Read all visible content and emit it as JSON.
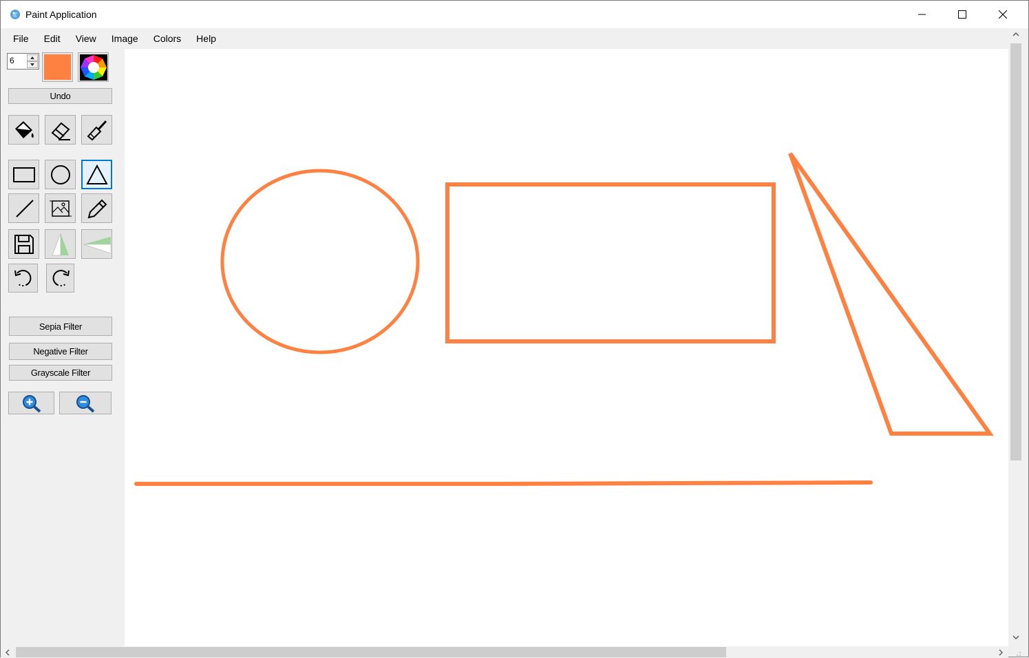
{
  "window": {
    "title": "Paint Application",
    "controls": [
      "minimize",
      "maximize",
      "close"
    ]
  },
  "menu": {
    "items": [
      "File",
      "Edit",
      "View",
      "Image",
      "Colors",
      "Help"
    ]
  },
  "toolbar": {
    "brush_size": "6",
    "current_color": "#ff8142",
    "undo_label": "Undo",
    "tools_row1": [
      "fill-bucket-icon",
      "eraser-icon",
      "brush-icon"
    ],
    "tools_row2": [
      "rectangle-icon",
      "circle-icon",
      "triangle-icon"
    ],
    "tools_row3": [
      "line-icon",
      "image-icon",
      "pencil-icon"
    ],
    "tools_row4": [
      "save-icon",
      "flip-vertical-icon",
      "flip-horizontal-icon"
    ],
    "tools_row5": [
      "rotate-left-icon",
      "rotate-right-icon"
    ],
    "selected_tool": "triangle",
    "sepia_label": "Sepia Filter",
    "negative_label": "Negative Filter",
    "grayscale_label": "Grayscale Filter",
    "zoom_in_icon": "zoom-in-icon",
    "zoom_out_icon": "zoom-out-icon"
  },
  "canvas": {
    "background": "#ffffff",
    "stroke_color": "#ff8142",
    "shapes": [
      "ellipse",
      "rectangle",
      "triangle",
      "line"
    ]
  },
  "colors": {
    "accent": "#0078d7",
    "panel": "#f0f0f0",
    "stroke": "#ff8142"
  }
}
